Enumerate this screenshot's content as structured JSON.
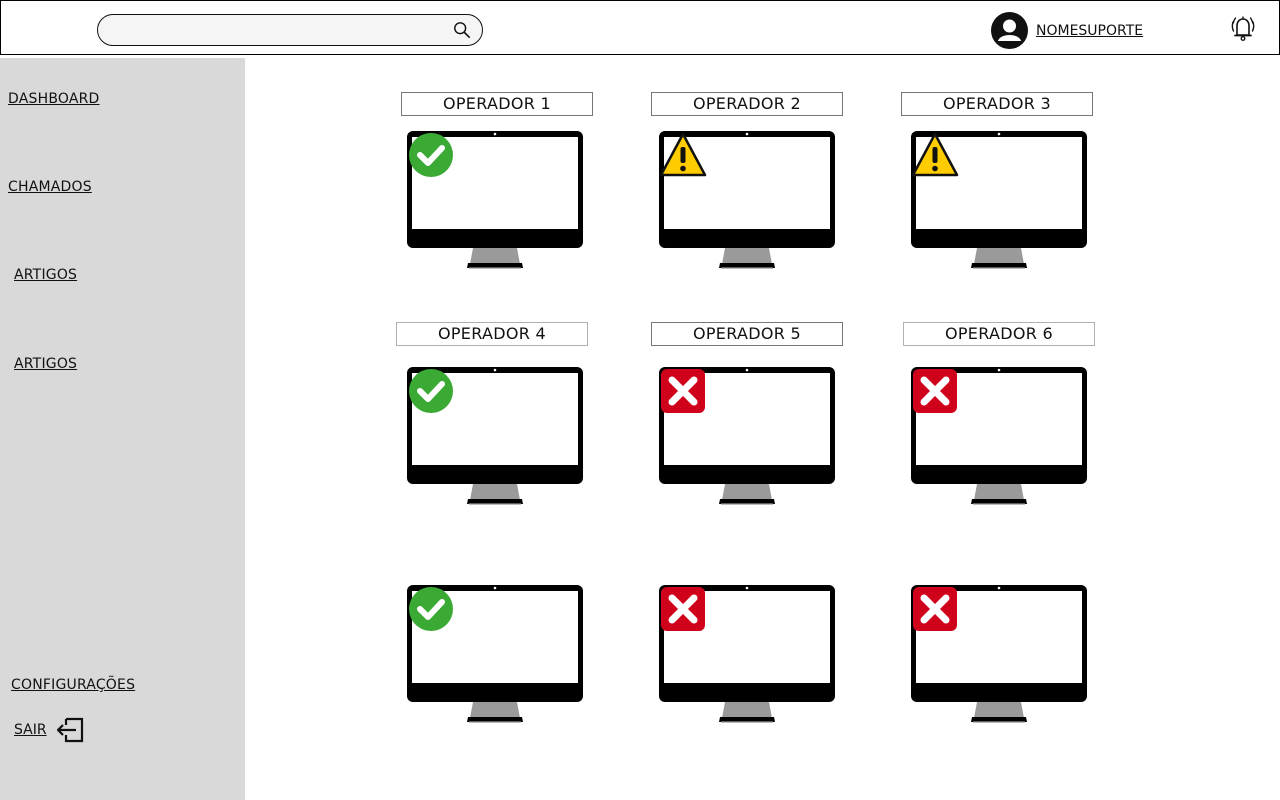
{
  "header": {
    "search": {
      "value": "",
      "placeholder": ""
    },
    "user": {
      "name": "NOMESUPORTE"
    }
  },
  "sidebar": {
    "items": [
      {
        "label": "DASHBOARD"
      },
      {
        "label": "CHAMADOS"
      },
      {
        "label": "ARTIGOS"
      },
      {
        "label": "ARTIGOS"
      }
    ],
    "settings_label": "CONFIGURAÇÕES",
    "exit_label": "SAIR"
  },
  "operators": [
    {
      "label": "OPERADOR 1",
      "status": "ok"
    },
    {
      "label": "OPERADOR 2",
      "status": "warning"
    },
    {
      "label": "OPERADOR 3",
      "status": "warning"
    },
    {
      "label": "OPERADOR 4",
      "status": "ok"
    },
    {
      "label": "OPERADOR 5",
      "status": "error"
    },
    {
      "label": "OPERADOR 6",
      "status": "error"
    },
    {
      "label": "",
      "status": "ok"
    },
    {
      "label": "",
      "status": "error"
    },
    {
      "label": "",
      "status": "error"
    }
  ],
  "icons": {
    "ok": "check-circle-icon",
    "warning": "warning-triangle-icon",
    "error": "x-square-icon"
  },
  "colors": {
    "ok": "#3aaa35",
    "warning": "#ffcc00",
    "error": "#d0021b",
    "sidebar": "#d9d9d9"
  }
}
